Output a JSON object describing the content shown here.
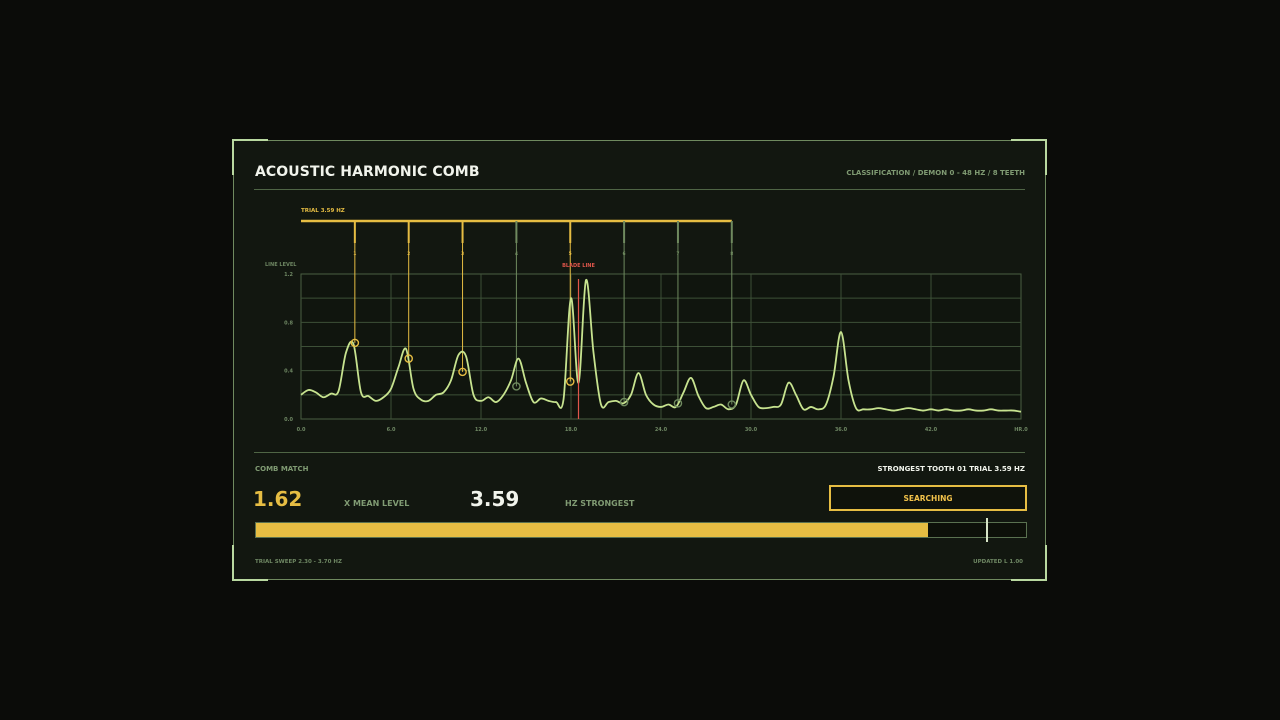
{
  "header": {
    "title": "ACOUSTIC HARMONIC COMB",
    "classification": "CLASSIFICATION / DEMON 0 - 48 HZ / 8 TEETH"
  },
  "chart_data": {
    "type": "line",
    "ylabel": "LINE LEVEL",
    "xlim": [
      0,
      48
    ],
    "ylim": [
      0,
      1.2
    ],
    "x_ticks": [
      "0.0",
      "6.0",
      "12.0",
      "18.0",
      "24.0",
      "30.0",
      "36.0",
      "42.0",
      "HR.0"
    ],
    "y_ticks": [
      "1.2",
      "0.8",
      "0.4",
      "0.0"
    ],
    "comb_label": "TRIAL 3.59 HZ",
    "blade_label": "BLADE LINE",
    "blade_hz": 18.5,
    "series": [
      {
        "x": [
          0.0,
          0.5,
          1.0,
          1.5,
          2.0,
          2.5,
          3.0,
          3.5,
          4.0,
          4.5,
          5.0,
          5.5,
          6.0,
          6.5,
          7.0,
          7.5,
          8.0,
          8.5,
          9.0,
          9.5,
          10.0,
          10.5,
          11.0,
          11.5,
          12.0,
          12.5,
          13.0,
          13.5,
          14.0,
          14.5,
          15.0,
          15.5,
          16.0,
          16.5,
          17.0,
          17.5,
          18.0,
          18.5,
          19.0,
          19.5,
          20.0,
          20.5,
          21.0,
          21.5,
          22.0,
          22.5,
          23.0,
          23.5,
          24.0,
          24.5,
          25.0,
          25.5,
          26.0,
          26.5,
          27.0,
          27.5,
          28.0,
          28.5,
          29.0,
          29.5,
          30.0,
          30.5,
          31.0,
          31.5,
          32.0,
          32.5,
          33.0,
          33.5,
          34.0,
          34.5,
          35.0,
          35.5,
          36.0,
          36.5,
          37.0,
          37.5,
          38.0,
          38.5,
          39.0,
          39.5,
          40.0,
          40.5,
          41.0,
          41.5,
          42.0,
          42.5,
          43.0,
          43.5,
          44.0,
          44.5,
          45.0,
          45.5,
          46.0,
          46.5,
          47.0,
          47.5,
          48.0
        ],
        "y": [
          0.2,
          0.24,
          0.22,
          0.18,
          0.21,
          0.23,
          0.55,
          0.62,
          0.22,
          0.19,
          0.15,
          0.18,
          0.25,
          0.43,
          0.58,
          0.25,
          0.16,
          0.15,
          0.2,
          0.22,
          0.32,
          0.53,
          0.52,
          0.2,
          0.15,
          0.18,
          0.14,
          0.2,
          0.32,
          0.5,
          0.3,
          0.14,
          0.17,
          0.15,
          0.14,
          0.16,
          1.0,
          0.3,
          1.15,
          0.55,
          0.12,
          0.14,
          0.15,
          0.13,
          0.2,
          0.38,
          0.2,
          0.12,
          0.1,
          0.12,
          0.1,
          0.22,
          0.34,
          0.19,
          0.09,
          0.1,
          0.12,
          0.08,
          0.12,
          0.32,
          0.2,
          0.1,
          0.09,
          0.1,
          0.12,
          0.3,
          0.2,
          0.08,
          0.1,
          0.08,
          0.12,
          0.35,
          0.72,
          0.32,
          0.09,
          0.08,
          0.08,
          0.09,
          0.08,
          0.07,
          0.08,
          0.09,
          0.08,
          0.07,
          0.08,
          0.07,
          0.08,
          0.07,
          0.07,
          0.08,
          0.07,
          0.07,
          0.08,
          0.07,
          0.07,
          0.07,
          0.06
        ]
      }
    ],
    "teeth": [
      {
        "label": "1",
        "hz": 3.59,
        "level": 0.63,
        "matched": true
      },
      {
        "label": "2",
        "hz": 7.18,
        "level": 0.5,
        "matched": true
      },
      {
        "label": "3",
        "hz": 10.77,
        "level": 0.39,
        "matched": true
      },
      {
        "label": "4",
        "hz": 14.36,
        "level": 0.27,
        "matched": false
      },
      {
        "label": "5",
        "hz": 17.95,
        "level": 0.31,
        "matched": true
      },
      {
        "label": "6",
        "hz": 21.54,
        "level": 0.14,
        "matched": false
      },
      {
        "label": "7",
        "hz": 25.13,
        "level": 0.13,
        "matched": false
      },
      {
        "label": "8",
        "hz": 28.72,
        "level": 0.12,
        "matched": false
      }
    ]
  },
  "stats": {
    "comb_match_label": "COMB MATCH",
    "strongest_tooth": "STRONGEST TOOTH 01   TRIAL 3.59 HZ",
    "mean_level": "1.62",
    "mean_level_label": "X MEAN LEVEL",
    "strongest_hz": "3.59",
    "strongest_hz_label": "HZ STRONGEST",
    "button_label": "SEARCHING",
    "progress": 0.873,
    "marker": 0.948
  },
  "footer": {
    "left": "TRIAL SWEEP 2.30 - 3.70 HZ",
    "right": "UPDATED L 1.00"
  },
  "colors": {
    "accent": "#e6bd43",
    "trace": "#c7e38f",
    "grid": "#3d5037",
    "blade": "#e0564b",
    "unmatched": "#6f8a5f"
  }
}
